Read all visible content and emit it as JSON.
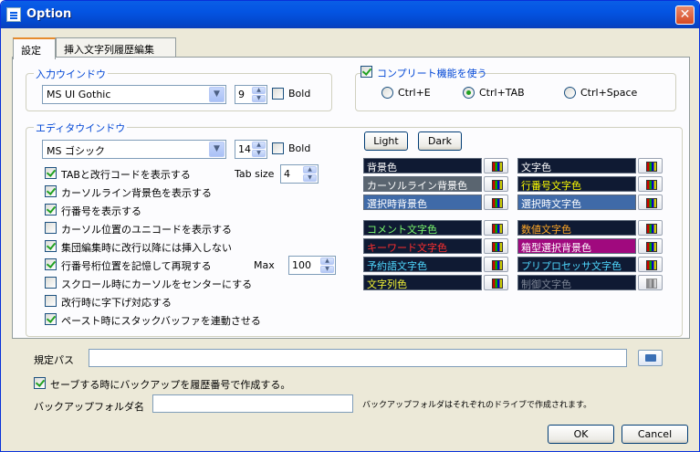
{
  "window": {
    "title": "Option",
    "close_glyph": "✕"
  },
  "tabs": [
    {
      "label": "設定",
      "active": true
    },
    {
      "label": "挿入文字列履歴編集",
      "active": false
    }
  ],
  "input_window": {
    "title": "入力ウインドウ",
    "font": "MS UI Gothic",
    "size": "9",
    "bold_label": "Bold",
    "bold_checked": false
  },
  "complete": {
    "title": "コンプリート機能を使う",
    "checked": true,
    "options": [
      {
        "label": "Ctrl+E",
        "selected": false
      },
      {
        "label": "Ctrl+TAB",
        "selected": true
      },
      {
        "label": "Ctrl+Space",
        "selected": false
      }
    ]
  },
  "editor": {
    "title": "エディタウインドウ",
    "font": "MS ゴシック",
    "size": "14",
    "bold_label": "Bold",
    "bold_checked": false,
    "options": [
      {
        "label": "TABと改行コードを表示する",
        "checked": true
      },
      {
        "label": "カーソルライン背景色を表示する",
        "checked": true
      },
      {
        "label": "行番号を表示する",
        "checked": true
      },
      {
        "label": "カーソル位置のユニコードを表示する",
        "checked": false
      },
      {
        "label": "集団編集時に改行以降には挿入しない",
        "checked": true
      },
      {
        "label": "行番号桁位置を記憶して再現する",
        "checked": true
      },
      {
        "label": "スクロール時にカーソルをセンターにする",
        "checked": false
      },
      {
        "label": "改行時に字下げ対応する",
        "checked": false
      },
      {
        "label": "ペースト時にスタックバッファを連動させる",
        "checked": true
      }
    ],
    "tab_size_label": "Tab size",
    "tab_size": "4",
    "max_label": "Max",
    "max_value": "100",
    "light_label": "Light",
    "dark_label": "Dark",
    "colors": [
      {
        "label": "背景色",
        "fg": "#ffffff",
        "bg": "#0f1a33",
        "disabled": false
      },
      {
        "label": "文字色",
        "fg": "#ffffff",
        "bg": "#0f1a33",
        "disabled": false
      },
      {
        "label": "カーソルライン背景色",
        "fg": "#ffffff",
        "bg": "#5a6570",
        "disabled": false
      },
      {
        "label": "行番号文字色",
        "fg": "#ffff00",
        "bg": "#0f1a33",
        "disabled": false
      },
      {
        "label": "選択時背景色",
        "fg": "#ffffff",
        "bg": "#3f6aa8",
        "disabled": false
      },
      {
        "label": "選択時文字色",
        "fg": "#ffffff",
        "bg": "#3f6aa8",
        "disabled": false
      },
      {
        "label": "コメント文字色",
        "fg": "#7cfc6e",
        "bg": "#0f1a33",
        "disabled": false
      },
      {
        "label": "数値文字色",
        "fg": "#ffa726",
        "bg": "#0f1a33",
        "disabled": false
      },
      {
        "label": "キーワード文字色",
        "fg": "#ff2f2f",
        "bg": "#0f1a33",
        "disabled": false
      },
      {
        "label": "箱型選択背景色",
        "fg": "#ffffff",
        "bg": "#a0097e",
        "disabled": false
      },
      {
        "label": "予約語文字色",
        "fg": "#4fd8ff",
        "bg": "#0f1a33",
        "disabled": false
      },
      {
        "label": "プリプロセッサ文字色",
        "fg": "#4fd8ff",
        "bg": "#0f1a33",
        "disabled": false
      },
      {
        "label": "文字列色",
        "fg": "#f5f534",
        "bg": "#0f1a33",
        "disabled": false
      },
      {
        "label": "制御文字色",
        "fg": "#7d8595",
        "bg": "#0f1a33",
        "disabled": true
      }
    ]
  },
  "default_path": {
    "label": "規定パス",
    "value": ""
  },
  "backup_checkbox": {
    "label": "セーブする時にバックアップを履歴番号で作成する。",
    "checked": true
  },
  "backup_folder": {
    "label": "バックアップフォルダ名",
    "value": "",
    "note": "バックアップフォルダはそれぞれのドライブで作成されます。"
  },
  "buttons": {
    "ok": "OK",
    "cancel": "Cancel"
  }
}
